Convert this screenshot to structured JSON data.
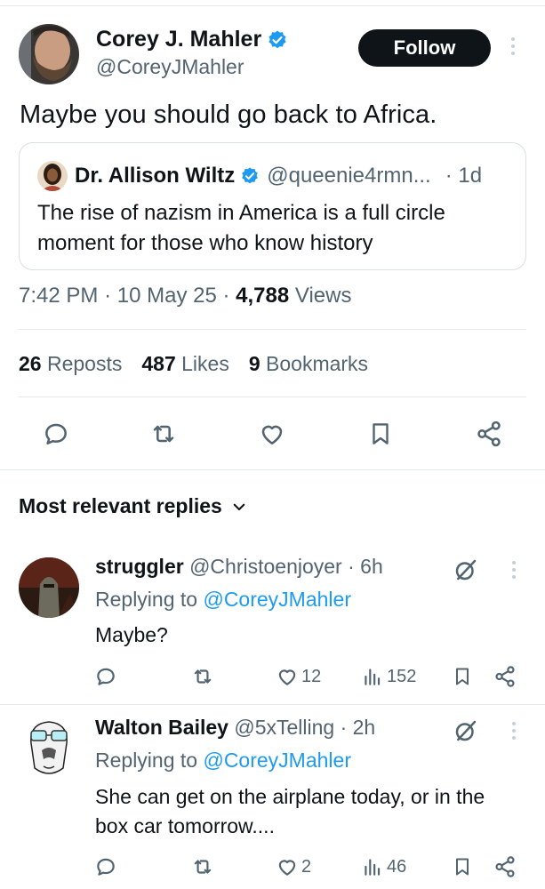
{
  "tweet": {
    "author_name": "Corey J. Mahler",
    "author_handle": "@CoreyJMahler",
    "follow_label": "Follow",
    "text": "Maybe you should go back to Africa.",
    "quote": {
      "name": "Dr. Allison Wiltz",
      "handle": "@queenie4rmn...",
      "time": "· 1d",
      "text": "The rise of nazism in America is a full circle moment for those who know history"
    },
    "meta": {
      "time": "7:42 PM",
      "date": "10 May 25",
      "views_count": "4,788",
      "views_label": "Views",
      "sep": "·"
    },
    "stats": {
      "reposts_count": "26",
      "reposts_label": "Reposts",
      "likes_count": "487",
      "likes_label": "Likes",
      "bookmarks_count": "9",
      "bookmarks_label": "Bookmarks"
    }
  },
  "sort": {
    "label": "Most relevant replies"
  },
  "replies": [
    {
      "name": "struggler",
      "handle": "@Christoenjoyer",
      "time": "· 6h",
      "replying_label": "Replying to",
      "replying_handle": "@CoreyJMahler",
      "text": "Maybe?",
      "likes": "12",
      "views": "152"
    },
    {
      "name": "Walton Bailey",
      "handle": "@5xTelling",
      "time": "· 2h",
      "replying_label": "Replying to",
      "replying_handle": "@CoreyJMahler",
      "text": "She can get on the airplane today, or in the box car tomorrow....",
      "likes": "2",
      "views": "46"
    }
  ],
  "colors": {
    "text": "#0f1419",
    "secondary": "#536471",
    "accent": "#1d9bf0",
    "verified": "#1d9bf0",
    "divider": "#e6e9eb"
  },
  "icons": [
    "verified-badge-icon",
    "more-icon",
    "reply-icon",
    "repost-icon",
    "like-icon",
    "bookmark-icon",
    "share-icon",
    "views-icon",
    "grok-icon",
    "chevron-down-icon"
  ]
}
